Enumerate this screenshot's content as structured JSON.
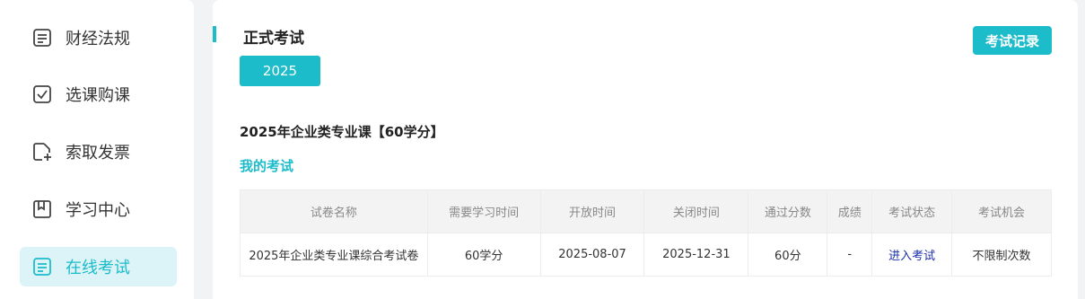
{
  "sidebar": {
    "items": [
      {
        "label": "财经法规",
        "icon": "document-icon"
      },
      {
        "label": "选课购课",
        "icon": "checkbox-icon"
      },
      {
        "label": "索取发票",
        "icon": "invoice-add-icon"
      },
      {
        "label": "学习中心",
        "icon": "bookmark-icon"
      },
      {
        "label": "在线考试",
        "icon": "exam-list-icon",
        "active": true
      }
    ]
  },
  "main": {
    "title": "正式考试",
    "record_button": "考试记录",
    "year_tab": "2025",
    "course_title": "2025年企业类专业课【60学分】",
    "my_exam_label": "我的考试",
    "table": {
      "headers": [
        "试卷名称",
        "需要学习时间",
        "开放时间",
        "关闭时间",
        "通过分数",
        "成绩",
        "考试状态",
        "考试机会"
      ],
      "rows": [
        [
          "2025年企业类专业课综合考试卷",
          "60学分",
          "2025-08-07",
          "2025-12-31",
          "60分",
          "-",
          "进入考试",
          "不限制次数"
        ]
      ]
    }
  },
  "colors": {
    "accent": "#1dbcca",
    "link": "#1a2ea8"
  }
}
